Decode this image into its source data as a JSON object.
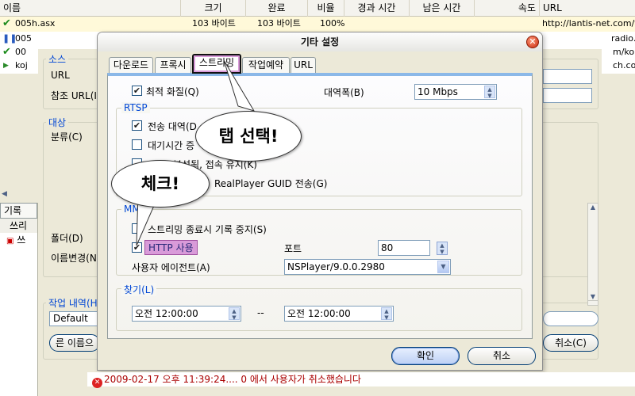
{
  "list": {
    "columns": [
      "이름",
      "크기",
      "완료",
      "비율",
      "경과 시간",
      "남은 시간",
      "속도",
      "URL"
    ],
    "rows": [
      {
        "name": "005h.asx",
        "size": "103 바이트",
        "done": "103 바이트",
        "ratio": "100%",
        "url": "http://lantis-net.com/yo"
      },
      {
        "name": "005",
        "url": "radio."
      },
      {
        "name": "00",
        "url": "m/ko"
      },
      {
        "name": "koj",
        "url": "ch.co"
      }
    ]
  },
  "background_dialog": {
    "source_group": "소스",
    "url_label": "URL",
    "ref_url_label": "참조 URL(I",
    "target_group": "대상",
    "category_label": "분류(C)",
    "folder_label": "폴더(D)",
    "rename_label": "이름변경(N",
    "job_group": "작업 내역(H",
    "default_value": "Default",
    "rename_button": "른 이름으",
    "cancel_button": "취소(C)",
    "log_tab": "기록",
    "log_sub": "쓰리",
    "log_item": "쓰"
  },
  "dialog": {
    "title": "기타 설정",
    "tabs": [
      "다운로드",
      "프록시",
      "스트리밍",
      "작업예약",
      "URL"
    ],
    "active_tab": 2,
    "best_quality_label": "최적 화질(Q)",
    "bandwidth_label": "대역폭(B)",
    "bandwidth_value": "10 Mbps",
    "rtsp_group": "RTSP",
    "transfer_label": "전송 대역(D",
    "wait_label": "대기시간 증",
    "smil_label": "SMIL 분석됨, 접속 유지(K)",
    "guid_label": "RealPlayer GUID 전송(G)",
    "mms_group": "MMS",
    "stop_log_label": "스트리밍 종료시 기록 중지(S)",
    "http_label": "HTTP 사용",
    "port_label": "포트",
    "port_value": "80",
    "useragent_label": "사용자 에이전트(A)",
    "useragent_value": "NSPlayer/9.0.0.2980",
    "find_group": "찾기(L)",
    "time_from": "오전 12:00:00",
    "time_sep": "--",
    "time_to": "오전 12:00:00",
    "ok_button": "확인",
    "cancel_button": "취소"
  },
  "callouts": {
    "tab_select": "탭 선택!",
    "check": "체크!"
  },
  "status_line": "2009-02-17 오후 11:39:24.... 0 에서 사용자가 취소했습니다",
  "colors": {
    "highlight": "#d99bd9",
    "accent_blue": "#0046d5",
    "error_red": "#aa0000"
  },
  "icons": {
    "close": "close-icon",
    "error": "error-icon",
    "check": "check-icon"
  }
}
